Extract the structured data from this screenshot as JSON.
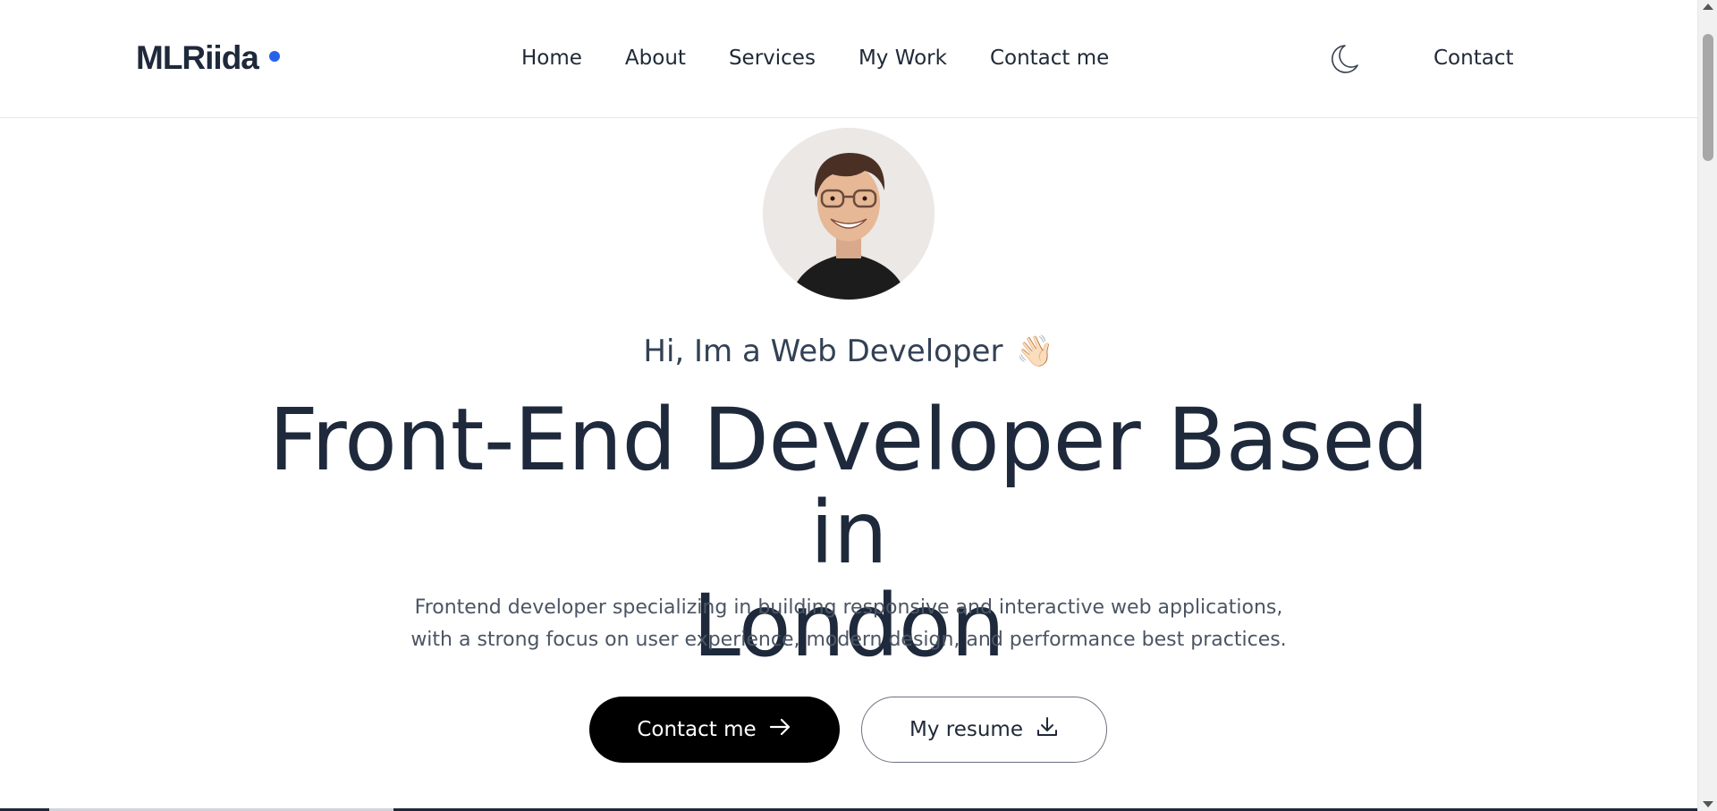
{
  "header": {
    "logo": "MLRiida",
    "nav": [
      "Home",
      "About",
      "Services",
      "My Work",
      "Contact me"
    ],
    "theme_toggle_icon": "moon-icon",
    "contact_label": "Contact"
  },
  "hero": {
    "greeting": "Hi, Im a Web Developer",
    "greeting_emoji": "👋🏻",
    "headline_line1": "Front-End Developer Based in",
    "headline_line2": "London",
    "description_line1": "Frontend developer specializing in building responsive and interactive web applications,",
    "description_line2": "with a strong focus on user experience, modern design, and performance best practices.",
    "primary_button": "Contact me",
    "secondary_button": "My resume"
  },
  "colors": {
    "accent": "#2563eb",
    "text": "#1e293b",
    "button_primary": "#000000"
  }
}
